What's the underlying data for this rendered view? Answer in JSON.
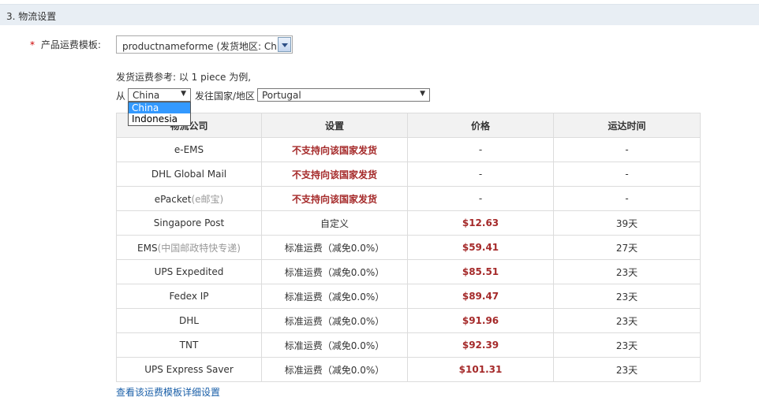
{
  "section": {
    "title": "3. 物流设置"
  },
  "template": {
    "required_mark": "*",
    "label": "产品运费模板:",
    "selected": "productnameforme (发货地区: China)"
  },
  "reference": {
    "text": "发货运费参考: 以 1 piece 为例,"
  },
  "from": {
    "label": "从",
    "selected": "China",
    "options": [
      "China",
      "Indonesia"
    ]
  },
  "to": {
    "label": "发往国家/地区",
    "selected": "Portugal"
  },
  "icons": {
    "dropdown": "chevron-down-icon"
  },
  "colors": {
    "price": "#a52a2a",
    "header_bg": "#e8eef4",
    "link": "#1a5fa8",
    "option_highlight": "#3399ff"
  },
  "table": {
    "headers": [
      "物流公司",
      "设置",
      "价格",
      "运达时间"
    ],
    "rows": [
      {
        "company": "e-EMS",
        "company_note": "",
        "setting": "不支持向该国家发货",
        "unsupported": true,
        "price": "-",
        "time": "-"
      },
      {
        "company": "DHL Global Mail",
        "company_note": "",
        "setting": "不支持向该国家发货",
        "unsupported": true,
        "price": "-",
        "time": "-"
      },
      {
        "company": "ePacket",
        "company_note": "(e邮宝)",
        "setting": "不支持向该国家发货",
        "unsupported": true,
        "price": "-",
        "time": "-"
      },
      {
        "company": "Singapore Post",
        "company_note": "",
        "setting": "自定义",
        "unsupported": false,
        "price": "$12.63",
        "time": "39天"
      },
      {
        "company": "EMS",
        "company_note": "(中国邮政特快专递)",
        "setting": "标准运费（减免0.0%）",
        "unsupported": false,
        "price": "$59.41",
        "time": "27天"
      },
      {
        "company": "UPS Expedited",
        "company_note": "",
        "setting": "标准运费（减免0.0%）",
        "unsupported": false,
        "price": "$85.51",
        "time": "23天"
      },
      {
        "company": "Fedex IP",
        "company_note": "",
        "setting": "标准运费（减免0.0%）",
        "unsupported": false,
        "price": "$89.47",
        "time": "23天"
      },
      {
        "company": "DHL",
        "company_note": "",
        "setting": "标准运费（减免0.0%）",
        "unsupported": false,
        "price": "$91.96",
        "time": "23天"
      },
      {
        "company": "TNT",
        "company_note": "",
        "setting": "标准运费（减免0.0%）",
        "unsupported": false,
        "price": "$92.39",
        "time": "23天"
      },
      {
        "company": "UPS Express Saver",
        "company_note": "",
        "setting": "标准运费（减免0.0%）",
        "unsupported": false,
        "price": "$101.31",
        "time": "23天"
      }
    ]
  },
  "detail_link": "查看该运费模板详细设置"
}
